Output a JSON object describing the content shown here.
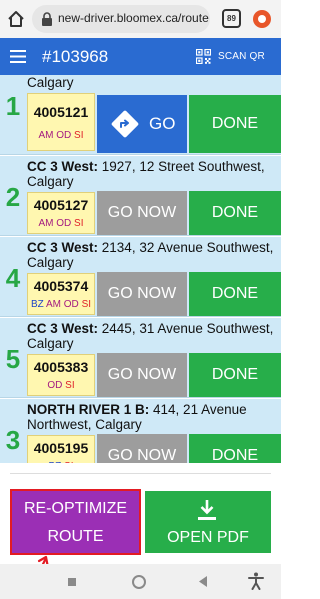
{
  "browser": {
    "url": "new-driver.bloomex.ca/route",
    "tab_count": "89"
  },
  "header": {
    "title": "#103968",
    "scan_label": "SCAN QR"
  },
  "stops": [
    {
      "number": "1",
      "name": "",
      "address": "Calgary",
      "code": "4005121",
      "tags": [
        "AM",
        "OD",
        "SI"
      ],
      "primary_label": "GO",
      "primary_type": "go",
      "done_label": "DONE"
    },
    {
      "number": "2",
      "name": "CC 3 West:",
      "address": "1927, 12 Street Southwest, Calgary",
      "code": "4005127",
      "tags": [
        "AM",
        "OD",
        "SI"
      ],
      "primary_label": "GO NOW",
      "primary_type": "go-now",
      "done_label": "DONE"
    },
    {
      "number": "4",
      "name": "CC 3 West:",
      "address": "2134, 32 Avenue Southwest, Calgary",
      "code": "4005374",
      "tags": [
        "BZ",
        "AM",
        "OD",
        "SI"
      ],
      "primary_label": "GO NOW",
      "primary_type": "go-now",
      "done_label": "DONE"
    },
    {
      "number": "5",
      "name": "CC 3 West:",
      "address": "2445, 31 Avenue Southwest, Calgary",
      "code": "4005383",
      "tags": [
        "OD",
        "SI"
      ],
      "primary_label": "GO NOW",
      "primary_type": "go-now",
      "done_label": "DONE"
    },
    {
      "number": "3",
      "name": "NORTH RIVER 1 B:",
      "address": "414, 21 Avenue Northwest, Calgary",
      "code": "4005195",
      "tags": [
        "BZ",
        "SI"
      ],
      "primary_label": "GO NOW",
      "primary_type": "go-now",
      "done_label": "DONE"
    }
  ],
  "actions": {
    "reoptimize_line1": "RE-OPTIMIZE",
    "reoptimize_line2": "ROUTE",
    "open_pdf": "OPEN PDF"
  },
  "colors": {
    "header_blue": "#2a6bd1",
    "done_green": "#27ae4a",
    "go_now_gray": "#9d9d9d",
    "reoptimize_purple": "#9b2fb5",
    "stop_bg": "#cfe9f7",
    "code_bg": "#fff7b0",
    "highlight_red": "#e31b23"
  }
}
